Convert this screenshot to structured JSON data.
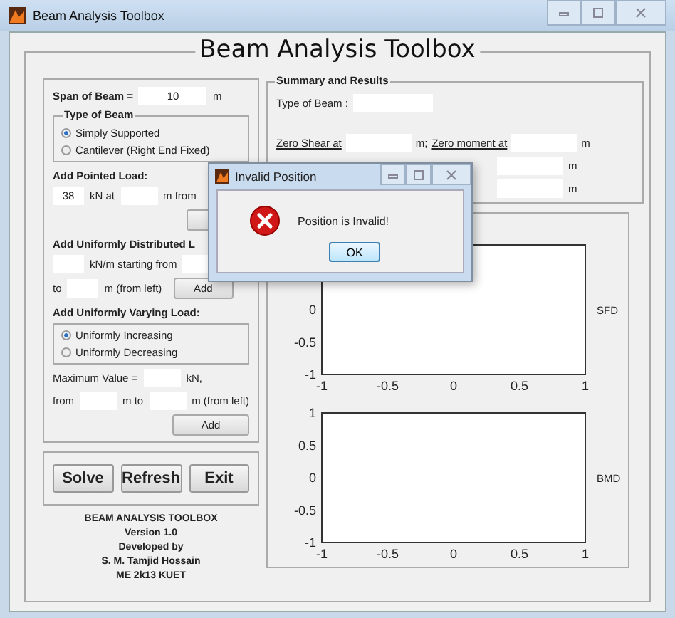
{
  "window": {
    "title": "Beam Analysis Toolbox"
  },
  "heading": "Beam Analysis Toolbox",
  "span": {
    "label": "Span of Beam =",
    "value": "10",
    "unit": "m"
  },
  "beam_type": {
    "title": "Type of Beam",
    "options": [
      {
        "label": "Simply Supported",
        "selected": true
      },
      {
        "label": "Cantilever  (Right End Fixed)",
        "selected": false
      }
    ]
  },
  "pointed_load": {
    "title": "Add Pointed Load:",
    "load": "38",
    "load_unit": "kN at",
    "position_unit": "m from"
  },
  "udl": {
    "title": "Add Uniformly Distributed L",
    "load_unit": "kN/m starting from",
    "to": "to",
    "end_unit": "m (from left)",
    "button": "Add"
  },
  "uvl": {
    "title": "Add Uniformly Varying Load:",
    "options": [
      {
        "label": "Uniformly Increasing",
        "selected": true
      },
      {
        "label": "Uniformly Decreasing",
        "selected": false
      }
    ],
    "max_label": "Maximum Value =",
    "max_unit": "kN,",
    "from": "from",
    "to": "m to",
    "end_unit": "m (from left)",
    "button": "Add"
  },
  "actions": [
    "Solve",
    "Refresh",
    "Exit"
  ],
  "credits": [
    "BEAM ANALYSIS TOOLBOX",
    "Version 1.0",
    "Developed by",
    "S. M. Tamjid Hossain",
    "ME 2k13 KUET"
  ],
  "summary": {
    "title": "Summary and Results",
    "type_label": "Type of Beam :",
    "zero_shear": "Zero Shear at",
    "zero_shear_unit": "m;",
    "zero_moment": "Zero moment at",
    "zero_moment_unit": "m",
    "extra_rows": [
      {
        "unit": "m"
      },
      {
        "unit": "m"
      }
    ]
  },
  "plots": [
    {
      "chart_data": {
        "type": "line",
        "ylabel": "SFD",
        "xlim": [
          -1,
          1
        ],
        "ylim": [
          -1,
          1
        ],
        "xticks": [
          -1,
          -0.5,
          0,
          0.5,
          1
        ],
        "yticks": [
          -1,
          -0.5,
          0
        ]
      }
    },
    {
      "chart_data": {
        "type": "line",
        "ylabel": "BMD",
        "xlim": [
          -1,
          1
        ],
        "ylim": [
          -1,
          1
        ],
        "xticks": [
          -1,
          -0.5,
          0,
          0.5,
          1
        ],
        "yticks": [
          -1,
          -0.5,
          0,
          0.5,
          1
        ]
      }
    }
  ],
  "dialog": {
    "title": "Invalid Position",
    "message": "Position is Invalid!",
    "button": "OK"
  }
}
